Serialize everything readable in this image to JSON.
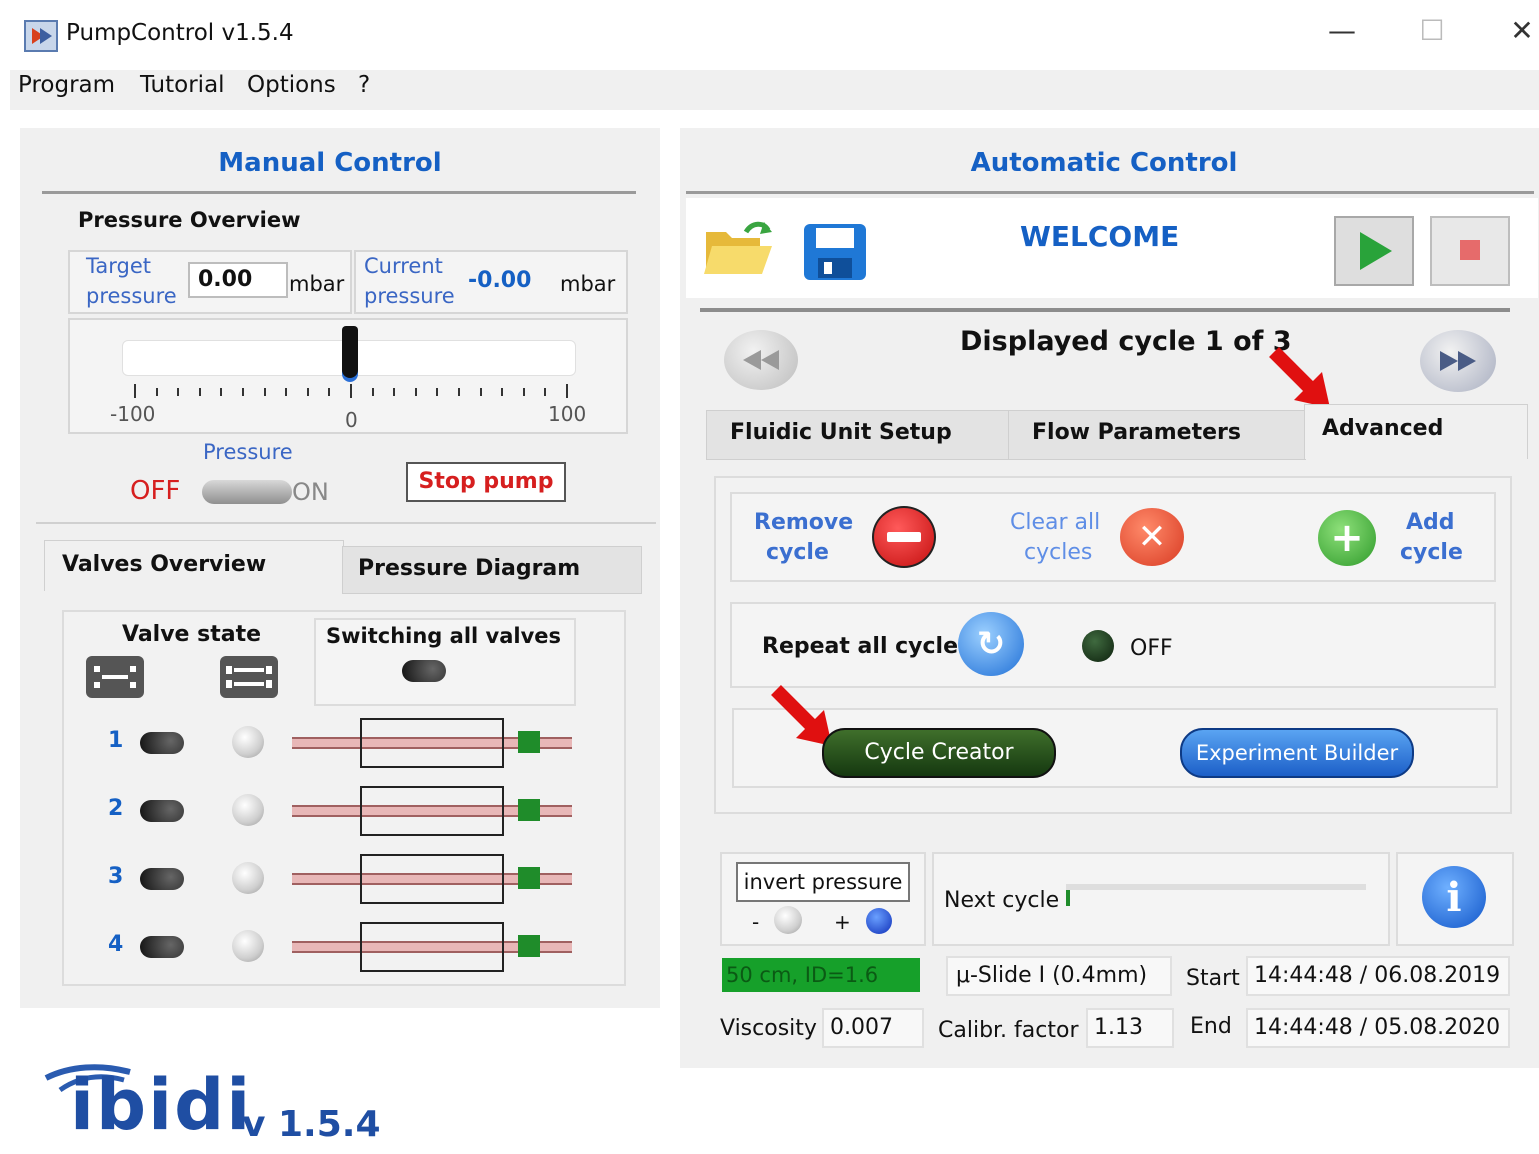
{
  "window": {
    "title": "PumpControl v1.5.4",
    "minimize": "—",
    "maximize": "☐",
    "close": "✕"
  },
  "menu": {
    "program": "Program",
    "tutorial": "Tutorial",
    "options": "Options",
    "help": "?"
  },
  "manual": {
    "header": "Manual Control",
    "overview_title": "Pressure Overview",
    "target_label_1": "Target",
    "target_label_2": "pressure",
    "target_value": "0.00",
    "target_unit": "mbar",
    "current_label_1": "Current",
    "current_label_2": "pressure",
    "current_value": "-0.00",
    "current_unit": "mbar",
    "slider": {
      "min_label": "-100",
      "mid_label": "0",
      "max_label": "100",
      "value": 0
    },
    "pressure_label": "Pressure",
    "off_label": "OFF",
    "on_label": "ON",
    "stop_button": "Stop pump",
    "tabs": {
      "valves": "Valves Overview",
      "diagram": "Pressure Diagram"
    },
    "valve_state": "Valve state",
    "switching_all": "Switching all valves",
    "valves": [
      "1",
      "2",
      "3",
      "4"
    ]
  },
  "auto": {
    "header": "Automatic Control",
    "welcome": "WELCOME",
    "cycle_display": "Displayed cycle 1 of 3",
    "tabs": {
      "fluidic": "Fluidic Unit Setup",
      "flow": "Flow Parameters",
      "advanced": "Advanced"
    },
    "remove_1": "Remove",
    "remove_2": "cycle",
    "clear_1": "Clear all",
    "clear_2": "cycles",
    "add_1": "Add",
    "add_2": "cycle",
    "repeat_label": "Repeat all cycles",
    "repeat_state": "OFF",
    "cycle_creator": "Cycle Creator",
    "experiment_builder": "Experiment Builder",
    "invert_pressure": "invert pressure",
    "minus": "-",
    "plus": "+",
    "next_cycle": "Next cycle",
    "tubing": "50 cm, ID=1.6",
    "slide": "μ-Slide I (0.4mm)",
    "start_label": "Start",
    "start_value": "14:44:48 / 06.08.2019",
    "end_label": "End",
    "end_value": "14:44:48 / 05.08.2020",
    "viscosity_label": "Viscosity",
    "viscosity_value": "0.007",
    "calibr_label": "Calibr. factor",
    "calibr_value": "1.13"
  },
  "logo": {
    "brand": "ibidi",
    "version": "v 1.5.4"
  },
  "colors": {
    "accent_blue": "#1560c4",
    "red": "#d61f1f",
    "green_button": "#1e4d12",
    "blue_button": "#2a73d9"
  }
}
